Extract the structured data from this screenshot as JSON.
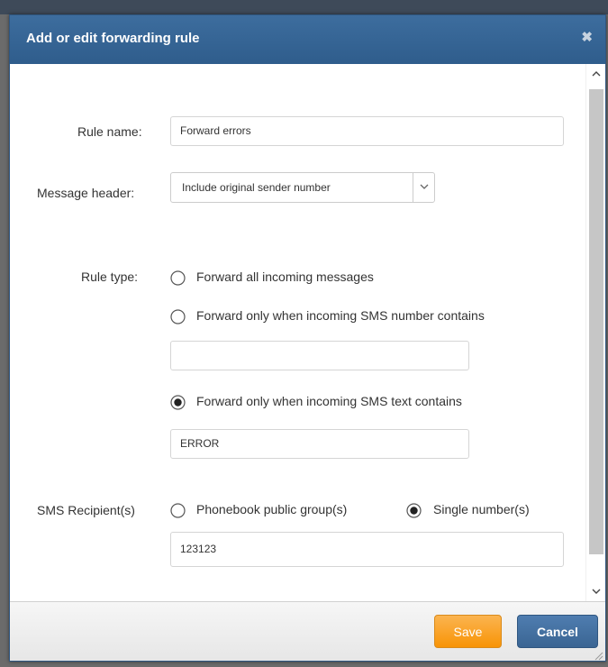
{
  "dialog": {
    "title": "Add or edit forwarding rule",
    "close_icon": "✖"
  },
  "form": {
    "rule_name": {
      "label": "Rule name:",
      "value": "Forward errors"
    },
    "message_header": {
      "label": "Message header:",
      "selected": "Include original sender number"
    },
    "rule_type": {
      "label": "Rule type:",
      "options": [
        {
          "label": "Forward all incoming messages",
          "checked": false
        },
        {
          "label": "Forward only when incoming SMS number contains",
          "checked": false
        },
        {
          "label": "Forward only when incoming SMS text contains",
          "checked": true
        }
      ],
      "number_contains_value": "",
      "text_contains_value": "ERROR"
    },
    "recipients": {
      "label": "SMS Recipient(s)",
      "options": [
        {
          "label": "Phonebook public group(s)",
          "checked": false
        },
        {
          "label": "Single number(s)",
          "checked": true
        }
      ],
      "value": "123123"
    }
  },
  "footer": {
    "save_label": "Save",
    "cancel_label": "Cancel"
  },
  "colors": {
    "titlebar": "#2f5d8c",
    "save": "#f89406",
    "cancel": "#3a6593"
  }
}
